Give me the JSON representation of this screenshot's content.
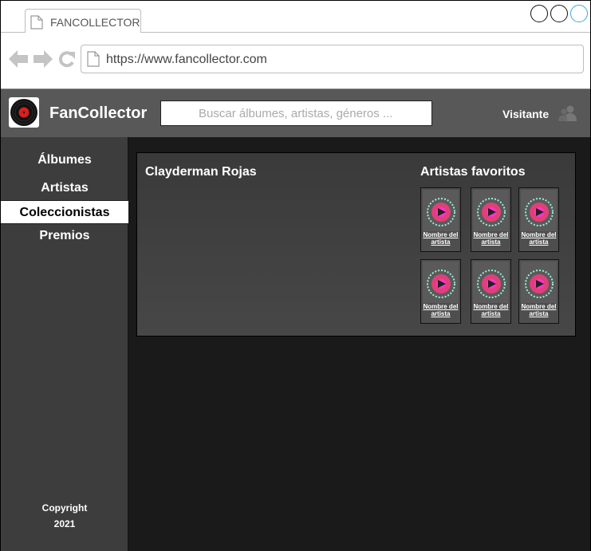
{
  "browser": {
    "tab_title": "FANCOLLECTOR",
    "url": "https://www.fancollector.com"
  },
  "header": {
    "brand": "FanCollector",
    "search_placeholder": "Buscar álbumes, artistas, géneros ...",
    "visitor_label": "Visitante"
  },
  "sidebar": {
    "items": [
      {
        "label": "Álbumes",
        "active": false
      },
      {
        "label": "Artistas",
        "active": false
      },
      {
        "label": "Coleccionistas",
        "active": true
      },
      {
        "label": "Premios",
        "active": false
      }
    ],
    "copyright_line1": "Copyright",
    "copyright_line2": "2021"
  },
  "profile": {
    "collector_name": "Clayderman Rojas",
    "favorites_title": "Artistas favoritos",
    "favorites": [
      {
        "name": "Nombre del artista"
      },
      {
        "name": "Nombre del artista"
      },
      {
        "name": "Nombre del artista"
      },
      {
        "name": "Nombre del artista"
      },
      {
        "name": "Nombre del artista"
      },
      {
        "name": "Nombre del artista"
      }
    ]
  },
  "colors": {
    "header_bg": "#585858",
    "sidebar_bg": "#3d3d3d",
    "main_bg": "#1a1a1a",
    "panel_bg": "#424242",
    "accent_pink": "#e0407a",
    "window_btn_highlight": "#3aa8e0"
  }
}
